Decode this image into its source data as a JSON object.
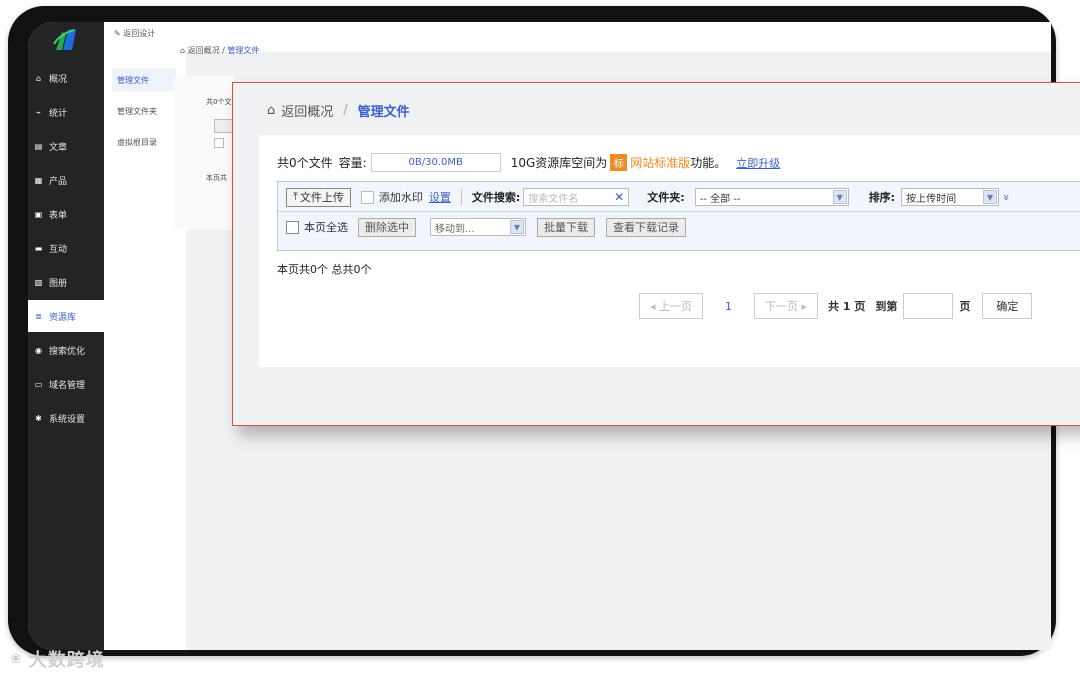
{
  "nav": {
    "items": [
      {
        "label": "概况",
        "icon": "home-icon"
      },
      {
        "label": "统计",
        "icon": "stats-icon"
      },
      {
        "label": "文章",
        "icon": "article-icon"
      },
      {
        "label": "产品",
        "icon": "product-icon"
      },
      {
        "label": "表单",
        "icon": "form-icon"
      },
      {
        "label": "互动",
        "icon": "chat-icon"
      },
      {
        "label": "图册",
        "icon": "album-icon"
      },
      {
        "label": "资源库",
        "icon": "database-icon"
      },
      {
        "label": "搜索优化",
        "icon": "seo-icon"
      },
      {
        "label": "域名管理",
        "icon": "domain-icon"
      },
      {
        "label": "系统设置",
        "icon": "gear-icon"
      }
    ]
  },
  "sub": {
    "back": "返回设计",
    "items": [
      "管理文件",
      "管理文件夹",
      "虚拟根目录"
    ]
  },
  "bg": {
    "crumb_home": "返回概况",
    "crumb_current": "管理文件",
    "info_partial": "共0个文",
    "count_partial": "本页共"
  },
  "zoom": {
    "crumb_home": "返回概况",
    "crumb_sep": "/",
    "crumb_current": "管理文件",
    "info": {
      "files": "共0个文件",
      "capacity_label": "容量:",
      "capacity_value": "0B/30.0MB",
      "space_text": "10G资源库空间为",
      "badge": "标",
      "edition": "网站标准版",
      "feature": "功能。",
      "upgrade": "立即升级"
    },
    "toolbar": {
      "upload": "文件上传",
      "watermark": "添加水印",
      "watermark_settings": "设置",
      "search_label": "文件搜索:",
      "search_placeholder": "搜索文件名",
      "clear": "✕",
      "folder_label": "文件夹:",
      "folder_value": "-- 全部 --",
      "sort_label": "排序:",
      "sort_value": "按上传时间",
      "expand": "»",
      "select_all": "本页全选",
      "delete_selected": "删除选中",
      "move_to": "移动到...",
      "batch_download": "批量下载",
      "view_download_log": "查看下载记录"
    },
    "count_text": "本页共0个 总共0个",
    "pager": {
      "prev": "◂ 上一页",
      "current": "1",
      "next": "下一页 ▸",
      "total": "共 1 页",
      "goto": "到第",
      "page_unit": "页",
      "confirm": "确定"
    }
  },
  "watermark": "大数跨境",
  "colors": {
    "accent": "#3a5fcd",
    "orange": "#f08a24",
    "overlay_border": "#d0533a",
    "sidebar": "#222426"
  }
}
